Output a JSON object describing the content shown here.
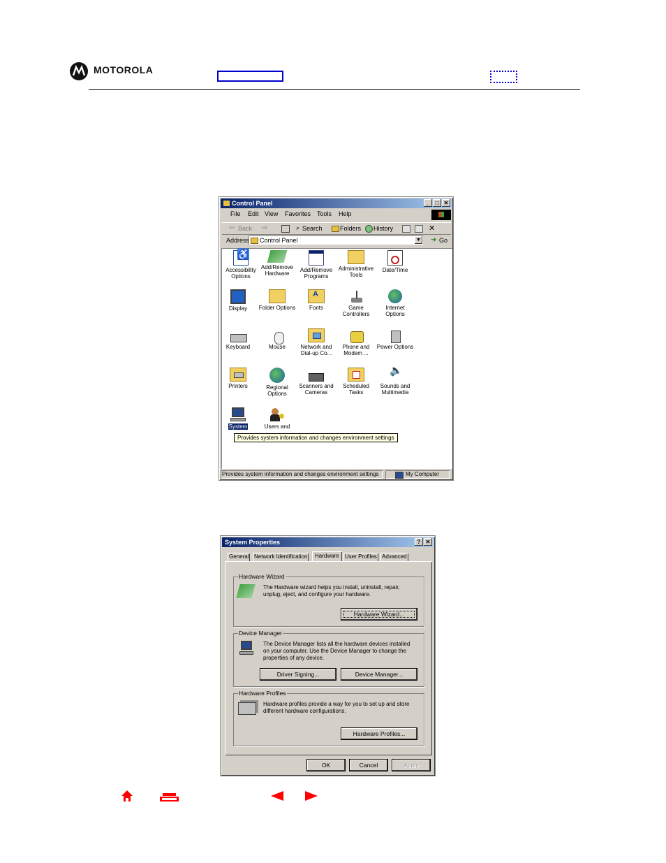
{
  "header": {
    "brand": "MOTOROLA"
  },
  "control_panel": {
    "title": "Control Panel",
    "menu": [
      "File",
      "Edit",
      "View",
      "Favorites",
      "Tools",
      "Help"
    ],
    "toolbar": {
      "back": "Back",
      "search": "Search",
      "folders": "Folders",
      "history": "History"
    },
    "address_label": "Address",
    "address_value": "Control Panel",
    "go_label": "Go",
    "icons": [
      {
        "label1": "Accessibility",
        "label2": "Options"
      },
      {
        "label1": "Add/Remove",
        "label2": "Hardware"
      },
      {
        "label1": "Add/Remove",
        "label2": "Programs"
      },
      {
        "label1": "Administrative",
        "label2": "Tools"
      },
      {
        "label1": "Date/Time",
        "label2": ""
      },
      {
        "label1": "Display",
        "label2": ""
      },
      {
        "label1": "Folder Options",
        "label2": ""
      },
      {
        "label1": "Fonts",
        "label2": ""
      },
      {
        "label1": "Game",
        "label2": "Controllers"
      },
      {
        "label1": "Internet",
        "label2": "Options"
      },
      {
        "label1": "Keyboard",
        "label2": ""
      },
      {
        "label1": "Mouse",
        "label2": ""
      },
      {
        "label1": "Network and",
        "label2": "Dial-up Co..."
      },
      {
        "label1": "Phone and",
        "label2": "Modem ..."
      },
      {
        "label1": "Power Options",
        "label2": ""
      },
      {
        "label1": "Printers",
        "label2": ""
      },
      {
        "label1": "Regional",
        "label2": "Options"
      },
      {
        "label1": "Scanners and",
        "label2": "Cameras"
      },
      {
        "label1": "Scheduled",
        "label2": "Tasks"
      },
      {
        "label1": "Sounds and",
        "label2": "Multimedia"
      },
      {
        "label1": "System",
        "label2": ""
      },
      {
        "label1": "Users and",
        "label2": ""
      }
    ],
    "tooltip": "Provides system information and changes environment settings",
    "status_text": "Provides system information and changes environment settings",
    "status_zone": "My Computer"
  },
  "system_properties": {
    "title": "System Properties",
    "tabs": [
      "General",
      "Network Identification",
      "Hardware",
      "User Profiles",
      "Advanced"
    ],
    "active_tab": "Hardware",
    "hardware_wizard": {
      "label": "Hardware Wizard",
      "text": "The Hardware wizard helps you install, uninstall, repair, unplug, eject, and configure your hardware.",
      "button": "Hardware Wizard..."
    },
    "device_manager": {
      "label": "Device Manager",
      "text": "The Device Manager lists all the hardware devices installed on your computer. Use the Device Manager to change the properties of any device.",
      "button_driver": "Driver Signing...",
      "button_dm": "Device Manager..."
    },
    "hardware_profiles": {
      "label": "Hardware Profiles",
      "text": "Hardware profiles provide a way for you to set up and store different hardware configurations.",
      "button": "Hardware Profiles..."
    },
    "ok": "OK",
    "cancel": "Cancel",
    "apply": "Apply"
  },
  "colors": {
    "accent_red": "#ff0000",
    "title_blue": "#0a246a",
    "link_blue": "#0000cc"
  }
}
